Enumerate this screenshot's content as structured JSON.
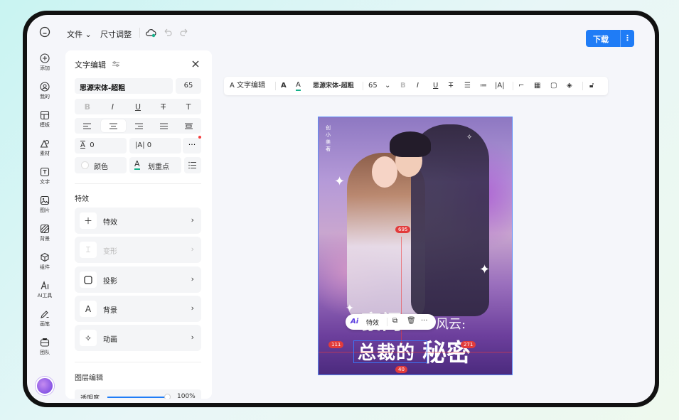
{
  "topbar": {
    "file_menu": "文件",
    "size_menu": "尺寸调整",
    "download": "下载",
    "download_more": "⋮"
  },
  "rail": {
    "items": [
      {
        "label": "添加",
        "icon": "plus-circle-icon"
      },
      {
        "label": "我的",
        "icon": "user-icon"
      },
      {
        "label": "模板",
        "icon": "template-icon"
      },
      {
        "label": "素材",
        "icon": "shapes-icon"
      },
      {
        "label": "文字",
        "icon": "text-icon"
      },
      {
        "label": "图片",
        "icon": "image-icon"
      },
      {
        "label": "背景",
        "icon": "background-icon"
      },
      {
        "label": "组件",
        "icon": "cube-icon"
      },
      {
        "label": "AI工具",
        "icon": "ai-icon"
      },
      {
        "label": "画笔",
        "icon": "brush-icon"
      },
      {
        "label": "团队",
        "icon": "team-icon"
      }
    ]
  },
  "panel": {
    "title": "文字编辑",
    "font_name": "思源宋体-超粗",
    "font_size": "65",
    "style_buttons": [
      "B",
      "I",
      "U",
      "T",
      "T"
    ],
    "letter_spacing": "0",
    "line_spacing_icon": "|A|",
    "line_spacing": "0",
    "more": "···",
    "color_label": "颜色",
    "highlight_label": "划重点",
    "effects_title": "特效",
    "effects": [
      {
        "label": "特效",
        "icon": "plus-icon",
        "disabled": false
      },
      {
        "label": "变形",
        "icon": "warp-icon",
        "disabled": true
      },
      {
        "label": "投影",
        "icon": "shadow-icon",
        "disabled": false
      },
      {
        "label": "背景",
        "icon": "text-bg-icon",
        "disabled": false
      },
      {
        "label": "动画",
        "icon": "animation-icon",
        "disabled": false
      }
    ],
    "layer_title": "图层编辑",
    "opacity_label": "透明度",
    "opacity_value": "100%",
    "opacity": 1.0
  },
  "toolbar": {
    "text_edit": "文字编辑",
    "font_name": "思源宋体-超粗",
    "font_size": "65"
  },
  "canvas": {
    "author": "创小美 著",
    "title_line1": "豪门",
    "title_line1b": "风云:",
    "title_line2": "总裁的",
    "title_line2b": "秘密",
    "badges": {
      "top": "695",
      "left": "111",
      "right": "271",
      "bottom": "40"
    },
    "context_bar": {
      "ai": "Ai",
      "effect": "特效",
      "more": "···"
    }
  },
  "colors": {
    "accent": "#1f7cf6",
    "guide": "#e23b3b"
  }
}
